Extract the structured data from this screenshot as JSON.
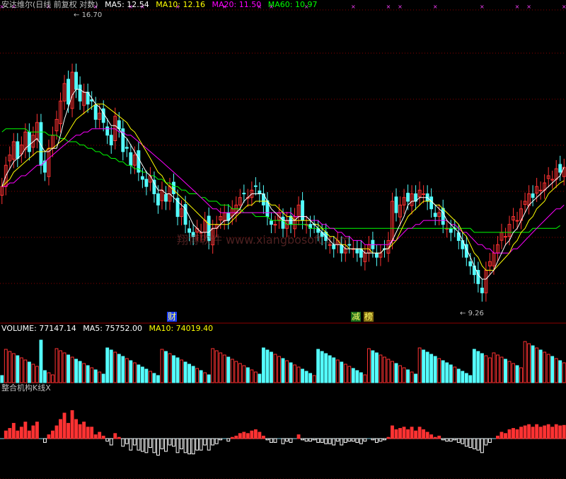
{
  "header": {
    "title": "安达维尔(日线 前复权 对数)",
    "ma5": "MA5: 12.54",
    "ma10": "MA10: 12.16",
    "ma20": "MA20: 11.50",
    "ma60": "MA60: 10.97"
  },
  "volume_header": {
    "volume": "VOLUME: 77147.14",
    "ma5": "MA5: 75752.00",
    "ma10": "MA10: 74019.40"
  },
  "indicator_header": {
    "title": "整合机构K线X"
  },
  "annotations": {
    "high": "16.70",
    "low": "9.26"
  },
  "events": {
    "cai": "财",
    "jian": "减",
    "bang": "榜"
  },
  "watermark": "翔博软件 www.xiangbosoft.com",
  "colors": {
    "up": "#ff3232",
    "down": "#54ffff",
    "ma5": "#ffffff",
    "ma10": "#ffff00",
    "ma20": "#ff00ff",
    "ma60": "#00ff00",
    "grid": "#8b0000",
    "baseline": "#7fd4e6",
    "event_cai_bg": "#1a3cff",
    "event_jian_bg": "#1a6b1a",
    "event_bang_bg": "#806a10",
    "event_text": "#ffff66",
    "magenta": "#ff40ff",
    "watermark": "#8b3b3b"
  },
  "chart_data": {
    "type": "candlestick",
    "scale": "log",
    "ylim": [
      9.0,
      18.0
    ],
    "high": 16.7,
    "low": 9.26,
    "last": {
      "ma5": 12.54,
      "ma10": 12.16,
      "ma20": 11.5,
      "ma60": 10.97
    },
    "close": [
      12.0,
      12.6,
      12.9,
      13.3,
      12.8,
      13.2,
      13.6,
      13.0,
      13.5,
      13.9,
      12.6,
      12.4,
      13.1,
      13.5,
      14.0,
      14.6,
      15.2,
      14.5,
      15.6,
      15.0,
      14.6,
      14.9,
      14.5,
      14.6,
      14.0,
      14.2,
      13.9,
      13.5,
      13.2,
      14.1,
      13.7,
      13.0,
      13.1,
      12.6,
      12.9,
      12.4,
      12.2,
      12.0,
      12.3,
      11.8,
      11.5,
      11.9,
      11.6,
      12.0,
      11.8,
      11.2,
      11.4,
      11.0,
      10.8,
      10.7,
      10.9,
      10.8,
      11.1,
      10.6,
      10.9,
      11.0,
      11.2,
      11.3,
      11.1,
      11.4,
      11.5,
      11.7,
      11.8,
      11.7,
      11.9,
      12.0,
      11.8,
      11.5,
      11.2,
      11.0,
      11.0,
      11.3,
      10.9,
      11.1,
      11.0,
      11.2,
      11.5,
      11.1,
      11.0,
      10.9,
      11.0,
      10.8,
      10.7,
      10.6,
      10.5,
      10.4,
      10.6,
      10.3,
      10.4,
      10.5,
      10.4,
      10.3,
      10.2,
      10.3,
      10.5,
      10.4,
      10.2,
      10.3,
      10.4,
      10.6,
      11.6,
      11.3,
      11.5,
      11.7,
      11.6,
      11.8,
      11.6,
      11.9,
      11.8,
      11.6,
      11.4,
      11.2,
      11.3,
      11.0,
      10.9,
      10.8,
      10.9,
      10.6,
      10.4,
      10.2,
      10.0,
      9.8,
      9.6,
      9.4,
      9.9,
      10.1,
      10.3,
      10.5,
      10.8,
      10.7,
      11.0,
      11.2,
      11.1,
      11.4,
      11.6,
      11.8,
      11.7,
      12.0,
      11.9,
      12.1,
      12.3,
      12.2,
      12.5,
      12.4,
      12.54
    ],
    "ma5": [
      12.0,
      12.3,
      12.5,
      12.7,
      12.8,
      12.9,
      13.1,
      13.2,
      13.3,
      13.4,
      13.2,
      13.0,
      13.0,
      13.1,
      13.1,
      13.5,
      14.0,
      14.4,
      14.8,
      15.0,
      15.0,
      14.9,
      14.9,
      14.7,
      14.5,
      14.4,
      14.2,
      14.0,
      13.8,
      13.8,
      13.7,
      13.5,
      13.4,
      13.2,
      13.0,
      12.8,
      12.6,
      12.4,
      12.3,
      12.1,
      11.9,
      11.9,
      11.8,
      11.8,
      11.7,
      11.6,
      11.5,
      11.4,
      11.2,
      11.0,
      10.9,
      10.8,
      10.8,
      10.8,
      10.9,
      10.9,
      11.0,
      11.1,
      11.1,
      11.2,
      11.3,
      11.4,
      11.6,
      11.7,
      11.8,
      11.8,
      11.8,
      11.8,
      11.6,
      11.4,
      11.3,
      11.2,
      11.1,
      11.1,
      11.1,
      11.1,
      11.2,
      11.2,
      11.2,
      11.1,
      11.0,
      10.9,
      10.8,
      10.7,
      10.6,
      10.5,
      10.5,
      10.5,
      10.4,
      10.4,
      10.4,
      10.4,
      10.4,
      10.3,
      10.3,
      10.3,
      10.3,
      10.3,
      10.4,
      10.4,
      10.6,
      10.8,
      11.0,
      11.2,
      11.5,
      11.6,
      11.6,
      11.7,
      11.7,
      11.7,
      11.6,
      11.5,
      11.4,
      11.3,
      11.1,
      11.0,
      10.9,
      10.8,
      10.6,
      10.4,
      10.2,
      10.0,
      9.8,
      9.7,
      9.7,
      9.8,
      9.9,
      10.1,
      10.3,
      10.5,
      10.6,
      10.8,
      10.9,
      11.1,
      11.3,
      11.5,
      11.6,
      11.7,
      11.8,
      11.9,
      12.0,
      12.1,
      12.2,
      12.3,
      12.54
    ],
    "ma10": [
      12.0,
      12.1,
      12.2,
      12.4,
      12.5,
      12.6,
      12.7,
      12.8,
      12.9,
      13.0,
      13.0,
      13.0,
      13.1,
      13.1,
      13.2,
      13.3,
      13.4,
      13.6,
      13.8,
      14.0,
      14.1,
      14.2,
      14.3,
      14.4,
      14.5,
      14.5,
      14.5,
      14.4,
      14.3,
      14.2,
      14.1,
      14.0,
      13.9,
      13.7,
      13.6,
      13.4,
      13.2,
      13.0,
      12.8,
      12.6,
      12.4,
      12.3,
      12.1,
      12.0,
      11.9,
      11.8,
      11.7,
      11.6,
      11.5,
      11.4,
      11.3,
      11.2,
      11.1,
      11.0,
      11.0,
      11.0,
      11.0,
      11.0,
      11.0,
      11.1,
      11.2,
      11.3,
      11.4,
      11.5,
      11.5,
      11.6,
      11.6,
      11.6,
      11.6,
      11.5,
      11.5,
      11.4,
      11.3,
      11.2,
      11.2,
      11.1,
      11.1,
      11.1,
      11.1,
      11.1,
      11.0,
      11.0,
      10.9,
      10.8,
      10.7,
      10.7,
      10.6,
      10.5,
      10.5,
      10.4,
      10.4,
      10.4,
      10.4,
      10.4,
      10.4,
      10.3,
      10.3,
      10.3,
      10.4,
      10.4,
      10.5,
      10.6,
      10.8,
      11.0,
      11.2,
      11.3,
      11.4,
      11.5,
      11.6,
      11.6,
      11.6,
      11.5,
      11.5,
      11.4,
      11.3,
      11.2,
      11.1,
      11.0,
      10.8,
      10.7,
      10.5,
      10.3,
      10.2,
      10.0,
      9.9,
      9.9,
      9.9,
      10.0,
      10.1,
      10.2,
      10.3,
      10.5,
      10.6,
      10.8,
      10.9,
      11.1,
      11.2,
      11.4,
      11.5,
      11.6,
      11.8,
      11.9,
      12.0,
      12.1,
      12.16
    ],
    "ma20": [
      12.0,
      12.0,
      12.1,
      12.1,
      12.2,
      12.3,
      12.3,
      12.4,
      12.5,
      12.6,
      12.6,
      12.7,
      12.8,
      12.9,
      13.0,
      13.1,
      13.2,
      13.3,
      13.4,
      13.5,
      13.5,
      13.6,
      13.6,
      13.7,
      13.7,
      13.7,
      13.7,
      13.7,
      13.7,
      13.7,
      13.6,
      13.6,
      13.5,
      13.5,
      13.4,
      13.3,
      13.2,
      13.1,
      13.0,
      12.9,
      12.8,
      12.7,
      12.6,
      12.5,
      12.4,
      12.3,
      12.2,
      12.1,
      12.0,
      11.9,
      11.8,
      11.7,
      11.6,
      11.5,
      11.4,
      11.4,
      11.3,
      11.3,
      11.3,
      11.3,
      11.3,
      11.3,
      11.3,
      11.3,
      11.3,
      11.3,
      11.3,
      11.3,
      11.3,
      11.3,
      11.3,
      11.3,
      11.3,
      11.3,
      11.3,
      11.2,
      11.2,
      11.2,
      11.2,
      11.1,
      11.1,
      11.1,
      11.0,
      11.0,
      10.9,
      10.9,
      10.8,
      10.8,
      10.7,
      10.7,
      10.6,
      10.6,
      10.6,
      10.5,
      10.5,
      10.5,
      10.5,
      10.5,
      10.5,
      10.5,
      10.6,
      10.6,
      10.7,
      10.8,
      10.9,
      10.9,
      11.0,
      11.0,
      11.1,
      11.1,
      11.1,
      11.1,
      11.1,
      11.1,
      11.1,
      11.0,
      11.0,
      10.9,
      10.8,
      10.8,
      10.7,
      10.6,
      10.5,
      10.5,
      10.4,
      10.4,
      10.3,
      10.3,
      10.3,
      10.3,
      10.3,
      10.4,
      10.4,
      10.5,
      10.6,
      10.7,
      10.8,
      10.9,
      11.0,
      11.1,
      11.2,
      11.3,
      11.4,
      11.4,
      11.5
    ],
    "ma60": [
      13.6,
      13.7,
      13.7,
      13.7,
      13.7,
      13.7,
      13.7,
      13.6,
      13.6,
      13.6,
      13.6,
      13.6,
      13.5,
      13.5,
      13.5,
      13.4,
      13.4,
      13.3,
      13.3,
      13.3,
      13.2,
      13.2,
      13.1,
      13.1,
      13.0,
      13.0,
      12.9,
      12.9,
      12.8,
      12.8,
      12.7,
      12.7,
      12.6,
      12.6,
      12.5,
      12.5,
      12.4,
      12.4,
      12.3,
      12.3,
      12.2,
      12.2,
      12.1,
      12.1,
      12.0,
      12.0,
      11.9,
      11.9,
      11.8,
      11.8,
      11.8,
      11.7,
      11.7,
      11.6,
      11.6,
      11.6,
      11.5,
      11.5,
      11.5,
      11.4,
      11.4,
      11.4,
      11.3,
      11.3,
      11.3,
      11.2,
      11.2,
      11.2,
      11.2,
      11.1,
      11.1,
      11.1,
      11.1,
      11.0,
      11.0,
      11.0,
      11.0,
      11.0,
      11.0,
      10.9,
      10.9,
      10.9,
      10.9,
      10.9,
      10.9,
      10.9,
      10.9,
      10.9,
      10.9,
      10.9,
      10.9,
      10.9,
      10.9,
      10.9,
      10.9,
      10.9,
      10.9,
      10.9,
      10.9,
      10.9,
      10.9,
      10.9,
      10.9,
      10.9,
      10.9,
      10.9,
      10.9,
      10.9,
      10.9,
      10.9,
      10.9,
      10.9,
      10.9,
      10.9,
      10.9,
      10.9,
      10.9,
      10.9,
      10.9,
      10.9,
      10.9,
      10.8,
      10.8,
      10.8,
      10.8,
      10.8,
      10.8,
      10.8,
      10.8,
      10.8,
      10.8,
      10.8,
      10.8,
      10.8,
      10.8,
      10.8,
      10.9,
      10.9,
      10.9,
      10.9,
      10.9,
      10.9,
      10.9,
      10.97
    ],
    "volume": {
      "last": 77147.14,
      "ma5": 75752.0,
      "ma10": 74019.4
    }
  }
}
